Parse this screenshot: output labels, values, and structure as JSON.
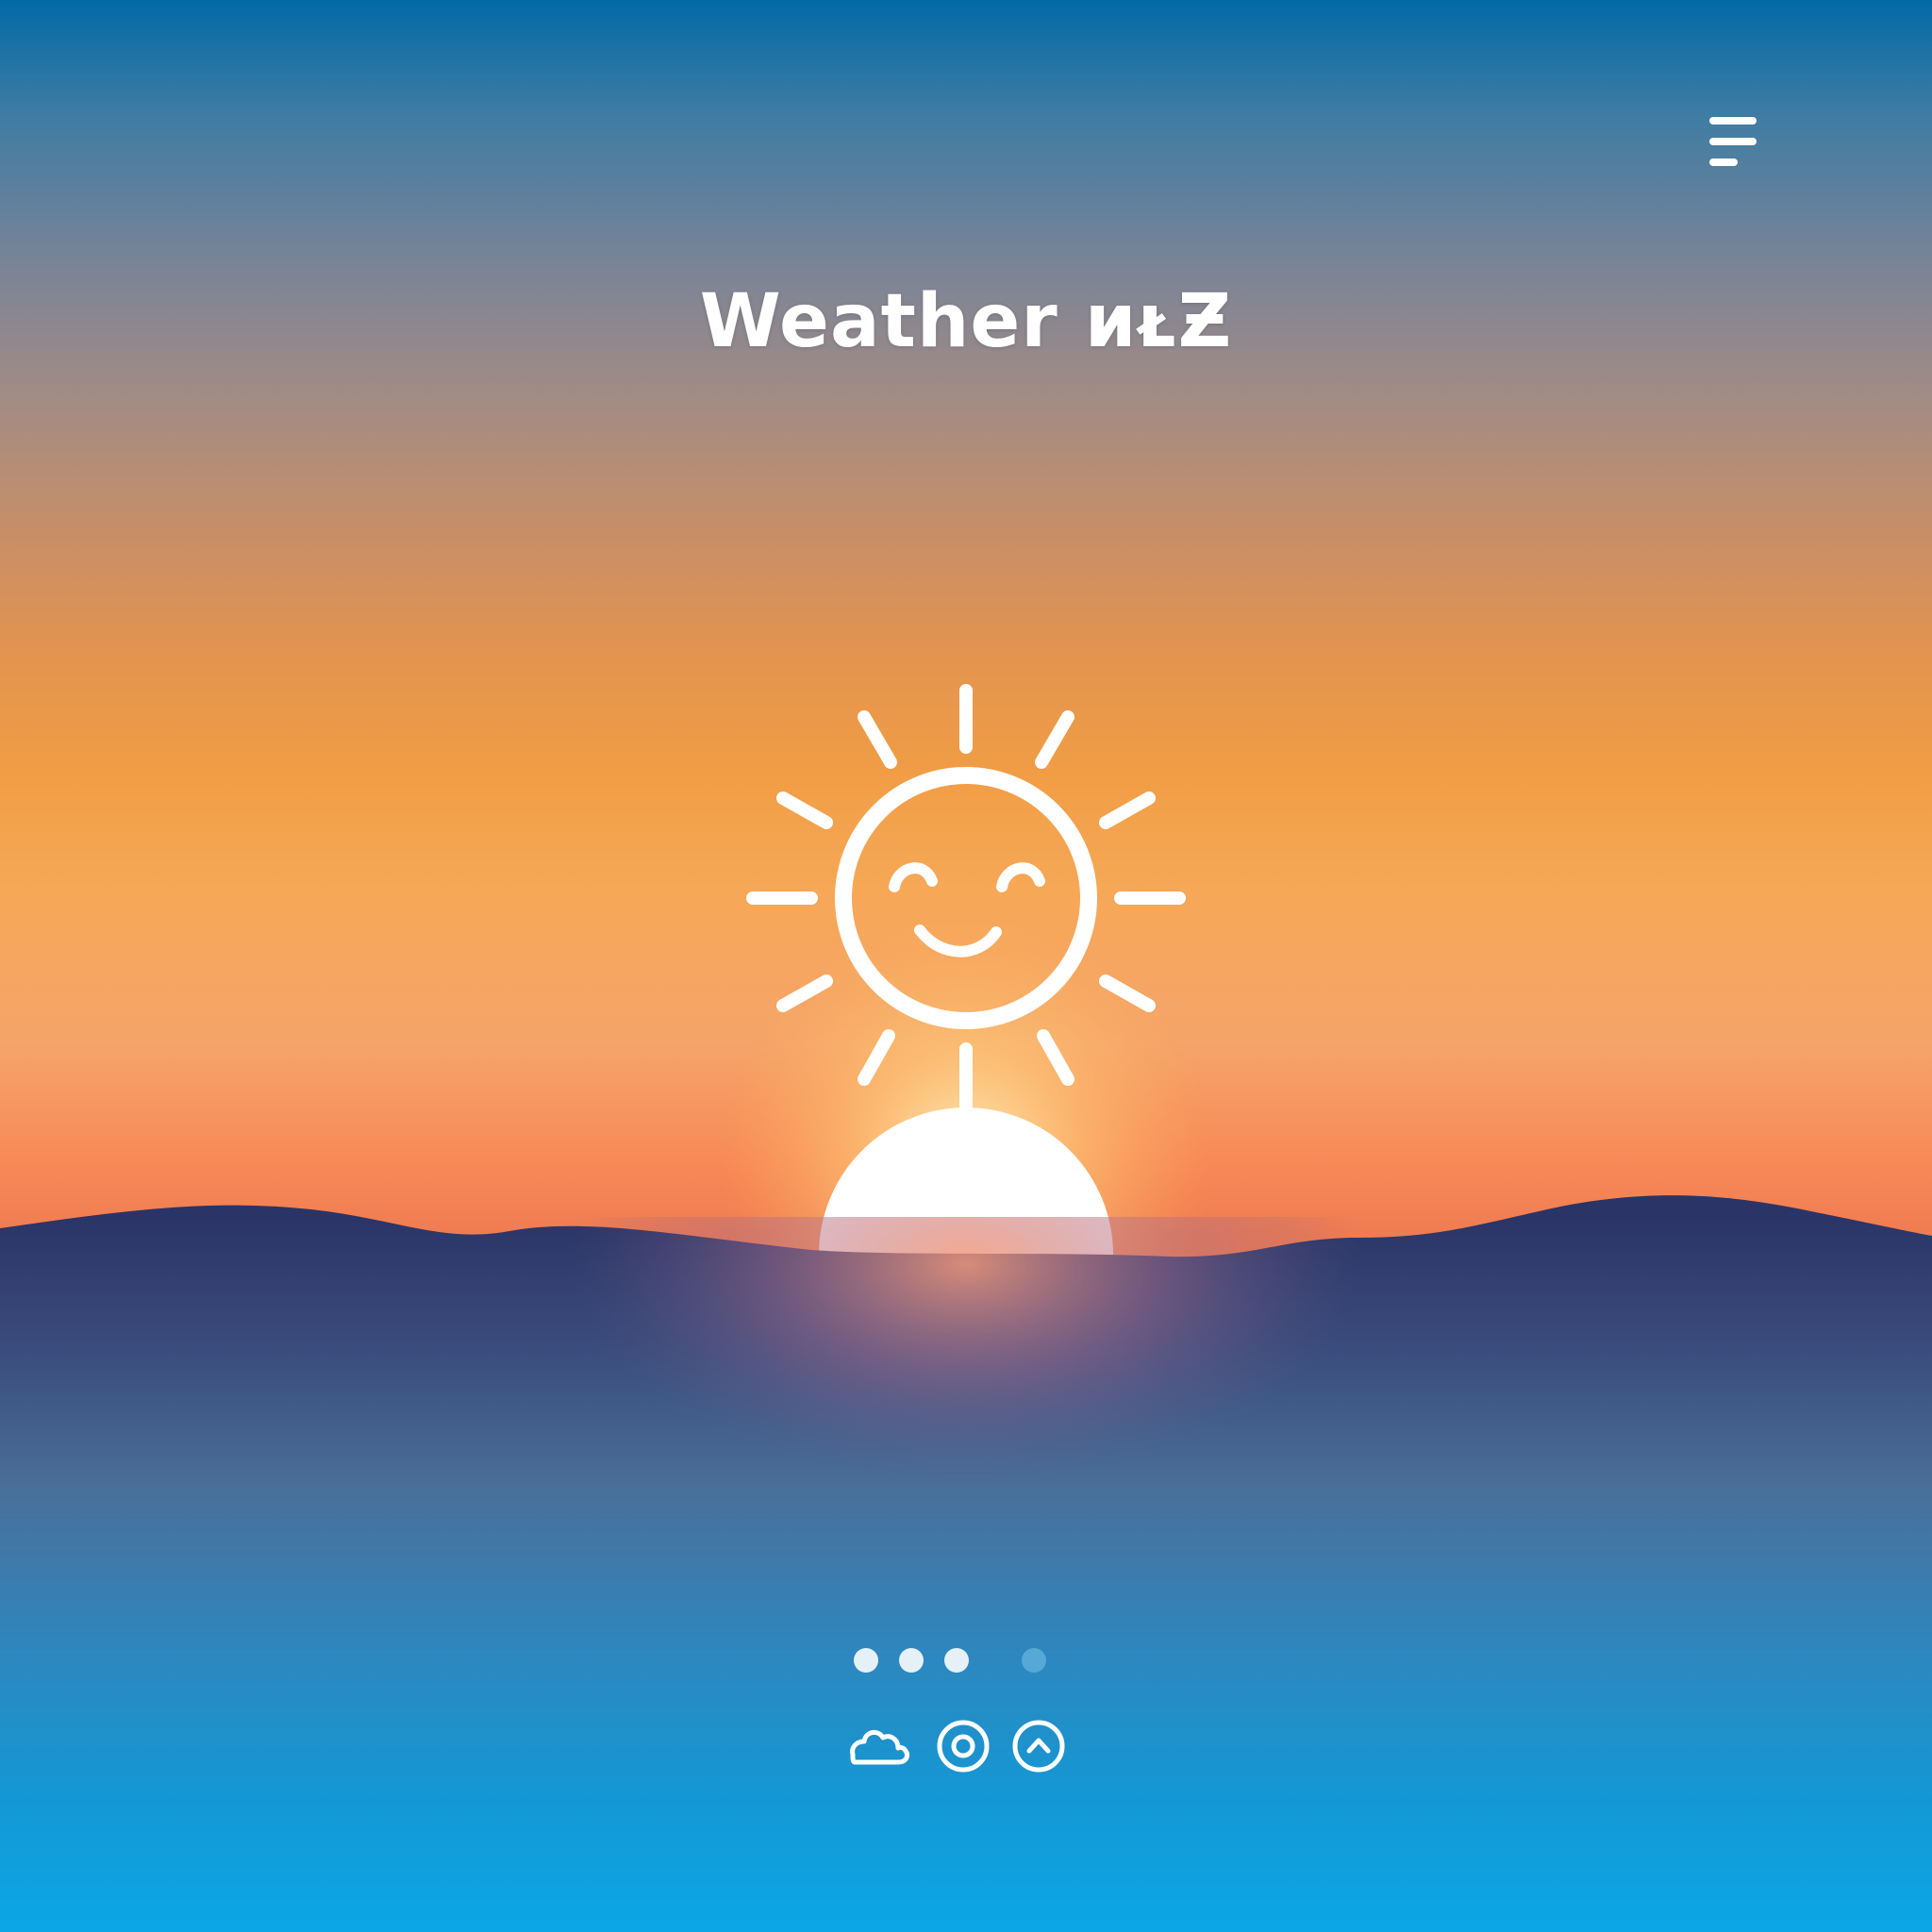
{
  "header": {
    "title": "Weather ᴎᴌƵ",
    "menu_icon": "hamburger-menu-icon"
  },
  "hero": {
    "icon": "smiling-sun-icon",
    "horizon_sun": "rising-sun"
  },
  "pager": {
    "count": 4,
    "active_dots": [
      0,
      1,
      2
    ],
    "inactive_dots": [
      3
    ]
  },
  "bottom_bar": {
    "icons": [
      "cloud-icon",
      "location-target-icon",
      "chevron-up-icon"
    ]
  },
  "colors": {
    "sky_top": "#026aa6",
    "sky_orange": "#f19d45",
    "horizon_glow": "#f07b52",
    "hills": "#2e3566",
    "water_bottom": "#0ca6e6",
    "icon_white": "#ffffff"
  }
}
